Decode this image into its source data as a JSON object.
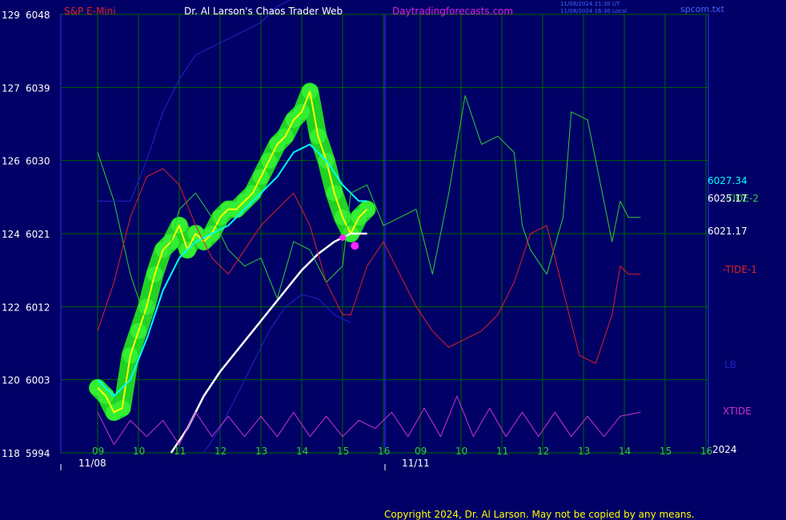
{
  "header": {
    "instrument": "S&P E-Mini",
    "title": "Dr. Al Larson's Chaos Trader Web",
    "site": "Daytradingforecasts.com",
    "stamp1": "11/08/2024 21:30 UT",
    "stamp2": "11/08/2024 16:30 Local",
    "file": "spcom.txt"
  },
  "footer": {
    "copyright": "Copyright 2024, Dr. Al Larson. May not be copied by any means."
  },
  "colors": {
    "background": "#000066",
    "price": "#ffff00",
    "ema_fast": "#00ffff",
    "ema_slow": "#ffffff",
    "tide2": "#33cc33",
    "tide1": "#dd2222",
    "lb": "#2222cc",
    "xtide": "#cc33cc",
    "glow": "#22dd22",
    "grid": "#006600"
  },
  "chart_data": {
    "type": "line",
    "title": "S&P E-Mini",
    "y_axis": {
      "ticks": [
        {
          "left": "129",
          "right": "6048"
        },
        {
          "left": "127",
          "right": "6039"
        },
        {
          "left": "126",
          "right": "6030"
        },
        {
          "left": "124",
          "right": "6021"
        },
        {
          "left": "122",
          "right": "6012"
        },
        {
          "left": "120",
          "right": "6003"
        },
        {
          "left": "118",
          "right": "5994"
        }
      ],
      "range": [
        5994,
        6048
      ]
    },
    "x_axis": {
      "day1_hours": [
        "09",
        "10",
        "11",
        "12",
        "13",
        "14",
        "15",
        "16"
      ],
      "day2_hours": [
        "09",
        "10",
        "11",
        "12",
        "13",
        "14",
        "15",
        "16"
      ],
      "dates": [
        "11/08",
        "11/11"
      ],
      "year": "2024"
    },
    "legend": [
      {
        "name": "6027.34",
        "color": "#00ffff"
      },
      {
        "name": "-TIDE-2",
        "color": "#33cc33"
      },
      {
        "name": "6025.17",
        "color": "#ffffff"
      },
      {
        "name": "6021.17",
        "color": "#ffffff"
      },
      {
        "name": "-TIDE-1",
        "color": "#dd2222"
      },
      {
        "name": "LB",
        "color": "#2222cc"
      },
      {
        "name": "XTIDE",
        "color": "#cc33cc"
      }
    ],
    "series": [
      {
        "name": "price",
        "values": [
          [
            9.0,
            6002
          ],
          [
            9.2,
            6001
          ],
          [
            9.4,
            5999
          ],
          [
            9.6,
            5999.5
          ],
          [
            9.8,
            6006
          ],
          [
            10.0,
            6009
          ],
          [
            10.2,
            6012
          ],
          [
            10.4,
            6016
          ],
          [
            10.6,
            6019
          ],
          [
            10.8,
            6020
          ],
          [
            11.0,
            6022
          ],
          [
            11.2,
            6019
          ],
          [
            11.4,
            6021
          ],
          [
            11.6,
            6020
          ],
          [
            11.8,
            6021
          ],
          [
            12.0,
            6023
          ],
          [
            12.2,
            6024
          ],
          [
            12.4,
            6024
          ],
          [
            12.6,
            6025
          ],
          [
            12.8,
            6026
          ],
          [
            13.0,
            6028
          ],
          [
            13.2,
            6030
          ],
          [
            13.4,
            6032
          ],
          [
            13.6,
            6033
          ],
          [
            13.8,
            6035
          ],
          [
            14.0,
            6036
          ],
          [
            14.2,
            6038.5
          ],
          [
            14.4,
            6033
          ],
          [
            14.6,
            6030
          ],
          [
            14.8,
            6026
          ],
          [
            15.0,
            6023
          ],
          [
            15.2,
            6021
          ],
          [
            15.4,
            6023
          ],
          [
            15.6,
            6024
          ]
        ]
      },
      {
        "name": "6027.34",
        "values": [
          [
            9.0,
            6003
          ],
          [
            9.4,
            6001
          ],
          [
            9.8,
            6003
          ],
          [
            10.2,
            6008
          ],
          [
            10.6,
            6014
          ],
          [
            11.0,
            6018
          ],
          [
            11.4,
            6020
          ],
          [
            11.8,
            6021
          ],
          [
            12.2,
            6022
          ],
          [
            12.6,
            6024
          ],
          [
            13.0,
            6026
          ],
          [
            13.4,
            6028
          ],
          [
            13.8,
            6031
          ],
          [
            14.2,
            6032
          ],
          [
            14.6,
            6030
          ],
          [
            15.0,
            6027
          ],
          [
            15.4,
            6025
          ],
          [
            15.6,
            6025
          ]
        ]
      },
      {
        "name": "6025.17",
        "values": [
          [
            10.8,
            5994
          ],
          [
            11.2,
            5997
          ],
          [
            11.6,
            6001
          ],
          [
            12.0,
            6004
          ],
          [
            12.4,
            6006.5
          ],
          [
            12.8,
            6009
          ],
          [
            13.2,
            6011.5
          ],
          [
            13.6,
            6014
          ],
          [
            14.0,
            6016.5
          ],
          [
            14.4,
            6018.5
          ],
          [
            14.8,
            6020
          ],
          [
            15.2,
            6021
          ],
          [
            15.6,
            6021
          ]
        ]
      },
      {
        "name": "-TIDE-2",
        "values": [
          [
            9.0,
            6031
          ],
          [
            9.4,
            6025
          ],
          [
            9.8,
            6016
          ],
          [
            10.2,
            6010
          ],
          [
            10.6,
            6016
          ],
          [
            11.0,
            6024
          ],
          [
            11.4,
            6026
          ],
          [
            11.8,
            6023
          ],
          [
            12.2,
            6019
          ],
          [
            12.6,
            6017
          ],
          [
            13.0,
            6018
          ],
          [
            13.4,
            6013
          ],
          [
            13.8,
            6020
          ],
          [
            14.2,
            6019
          ],
          [
            14.6,
            6015
          ],
          [
            15.0,
            6017
          ],
          [
            15.2,
            6026
          ],
          [
            15.6,
            6027
          ],
          [
            16.0,
            6022
          ],
          [
            16.8,
            6024
          ],
          [
            17.2,
            6016
          ],
          [
            17.6,
            6026
          ],
          [
            18.0,
            6038
          ],
          [
            18.4,
            6032
          ],
          [
            18.8,
            6033
          ],
          [
            19.2,
            6031
          ],
          [
            19.4,
            6022
          ],
          [
            19.6,
            6019
          ],
          [
            20.0,
            6016
          ],
          [
            20.4,
            6023
          ],
          [
            20.6,
            6036
          ],
          [
            21.0,
            6035
          ],
          [
            21.4,
            6025
          ],
          [
            21.6,
            6020
          ],
          [
            21.8,
            6025
          ],
          [
            22.0,
            6023
          ],
          [
            22.3,
            6023
          ]
        ]
      },
      {
        "name": "-TIDE-1",
        "values": [
          [
            9.0,
            6009
          ],
          [
            9.4,
            6015
          ],
          [
            9.8,
            6023
          ],
          [
            10.2,
            6028
          ],
          [
            10.6,
            6029
          ],
          [
            11.0,
            6027
          ],
          [
            11.4,
            6022
          ],
          [
            11.8,
            6018
          ],
          [
            12.2,
            6016
          ],
          [
            12.6,
            6019
          ],
          [
            13.0,
            6022
          ],
          [
            13.4,
            6024
          ],
          [
            13.8,
            6026
          ],
          [
            14.2,
            6022
          ],
          [
            14.6,
            6015
          ],
          [
            15.0,
            6011
          ],
          [
            15.2,
            6011
          ],
          [
            15.6,
            6017
          ],
          [
            16.0,
            6020
          ],
          [
            16.4,
            6016
          ],
          [
            16.8,
            6012
          ],
          [
            17.2,
            6009
          ],
          [
            17.6,
            6007
          ],
          [
            18.0,
            6008
          ],
          [
            18.4,
            6009
          ],
          [
            18.8,
            6011
          ],
          [
            19.2,
            6015
          ],
          [
            19.6,
            6021
          ],
          [
            20.0,
            6022
          ],
          [
            20.4,
            6014
          ],
          [
            20.8,
            6006
          ],
          [
            21.2,
            6005
          ],
          [
            21.6,
            6011
          ],
          [
            21.8,
            6017
          ],
          [
            22.0,
            6016
          ],
          [
            22.3,
            6016
          ]
        ]
      },
      {
        "name": "LB",
        "values": [
          [
            9.0,
            6025
          ],
          [
            9.4,
            6025
          ],
          [
            9.8,
            6025
          ],
          [
            10.2,
            6030
          ],
          [
            10.6,
            6036
          ],
          [
            11.0,
            6040
          ],
          [
            11.4,
            6043
          ],
          [
            11.8,
            6044
          ],
          [
            12.2,
            6045
          ],
          [
            12.6,
            6046
          ],
          [
            13.0,
            6047
          ],
          [
            13.4,
            6049
          ],
          [
            13.8,
            6050
          ],
          [
            14.2,
            6050
          ]
        ]
      },
      {
        "name": "LB lower",
        "values": [
          [
            11.6,
            5994
          ],
          [
            12.0,
            5997
          ],
          [
            12.4,
            6001
          ],
          [
            12.8,
            6005
          ],
          [
            13.2,
            6009
          ],
          [
            13.6,
            6012
          ],
          [
            14.0,
            6013.5
          ],
          [
            14.4,
            6013
          ],
          [
            14.8,
            6011
          ],
          [
            15.2,
            6010
          ]
        ]
      },
      {
        "name": "XTIDE",
        "values": [
          [
            9.0,
            5999
          ],
          [
            9.4,
            5995
          ],
          [
            9.8,
            5998
          ],
          [
            10.2,
            5996
          ],
          [
            10.6,
            5998
          ],
          [
            11.0,
            5995
          ],
          [
            11.4,
            5999
          ],
          [
            11.8,
            5996
          ],
          [
            12.2,
            5998.5
          ],
          [
            12.6,
            5996
          ],
          [
            13.0,
            5998.5
          ],
          [
            13.4,
            5996
          ],
          [
            13.8,
            5999
          ],
          [
            14.2,
            5996
          ],
          [
            14.6,
            5998.5
          ],
          [
            15.0,
            5996
          ],
          [
            15.4,
            5998
          ],
          [
            15.8,
            5997
          ],
          [
            16.2,
            5999
          ],
          [
            16.6,
            5996
          ],
          [
            17.0,
            5999.5
          ],
          [
            17.4,
            5996
          ],
          [
            17.8,
            6001
          ],
          [
            18.2,
            5996
          ],
          [
            18.6,
            5999.5
          ],
          [
            19.0,
            5996
          ],
          [
            19.4,
            5999
          ],
          [
            19.8,
            5996
          ],
          [
            20.2,
            5999
          ],
          [
            20.6,
            5996
          ],
          [
            21.0,
            5998.5
          ],
          [
            21.4,
            5996
          ],
          [
            21.8,
            5998.5
          ],
          [
            22.3,
            5999
          ]
        ]
      }
    ]
  }
}
